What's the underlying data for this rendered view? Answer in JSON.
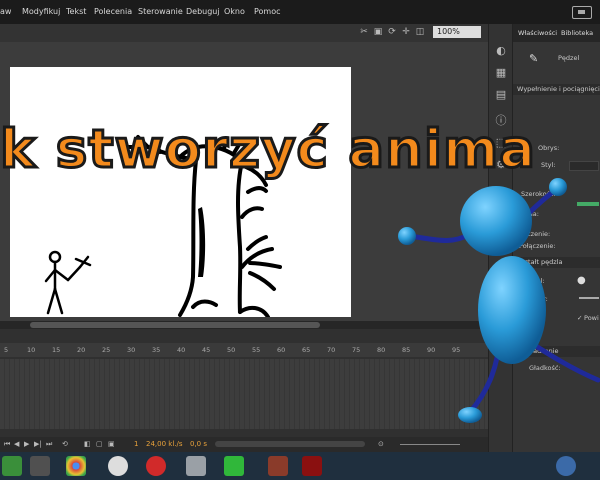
{
  "menu": {
    "items": [
      "aw",
      "Modyfikuj",
      "Tekst",
      "Polecenia",
      "Sterowanie",
      "Debuguj",
      "Okno",
      "Pomoc"
    ]
  },
  "stage": {
    "zoom": "100%"
  },
  "overlay": {
    "title": "k stworzyć anima"
  },
  "props": {
    "tab_properties": "Właściwości",
    "tab_library": "Biblioteka",
    "tool_name": "Pędzel",
    "section_fill_stroke": "Wypełnienie i pociągnięcie",
    "stroke_label": "Obrys:",
    "style_label": "Styl:",
    "width_label": "Szerokość:",
    "scale_label": "la:",
    "cap_label": "ończenie:",
    "join_label": "Połączenie:",
    "section_brush_shape": "Kształt pędzla",
    "brush_label": "ędzel:",
    "size_label": "miar:",
    "pressure_label": "Powi",
    "section_smoothing": "Wygładzanie",
    "smoothness_label": "Gładkość:"
  },
  "timeline": {
    "ticks": [
      "5",
      "10",
      "15",
      "20",
      "25",
      "30",
      "35",
      "40",
      "45",
      "50",
      "55",
      "60",
      "65",
      "70",
      "75",
      "80",
      "85",
      "90",
      "95"
    ],
    "frame": "1",
    "fps": "24,00 kl./s",
    "time": "0,0 s"
  },
  "colors": {
    "title_fill": "#f38a1c",
    "figure_blue": "#29a0d8",
    "limb_navy": "#1f2a9a"
  },
  "taskbar": {
    "icons": [
      "windows-icon",
      "gimp-icon",
      "chrome-icon",
      "hp-icon",
      "opera-icon",
      "app-k-icon",
      "camtasia-icon",
      "flash-icon",
      "help-icon"
    ]
  }
}
